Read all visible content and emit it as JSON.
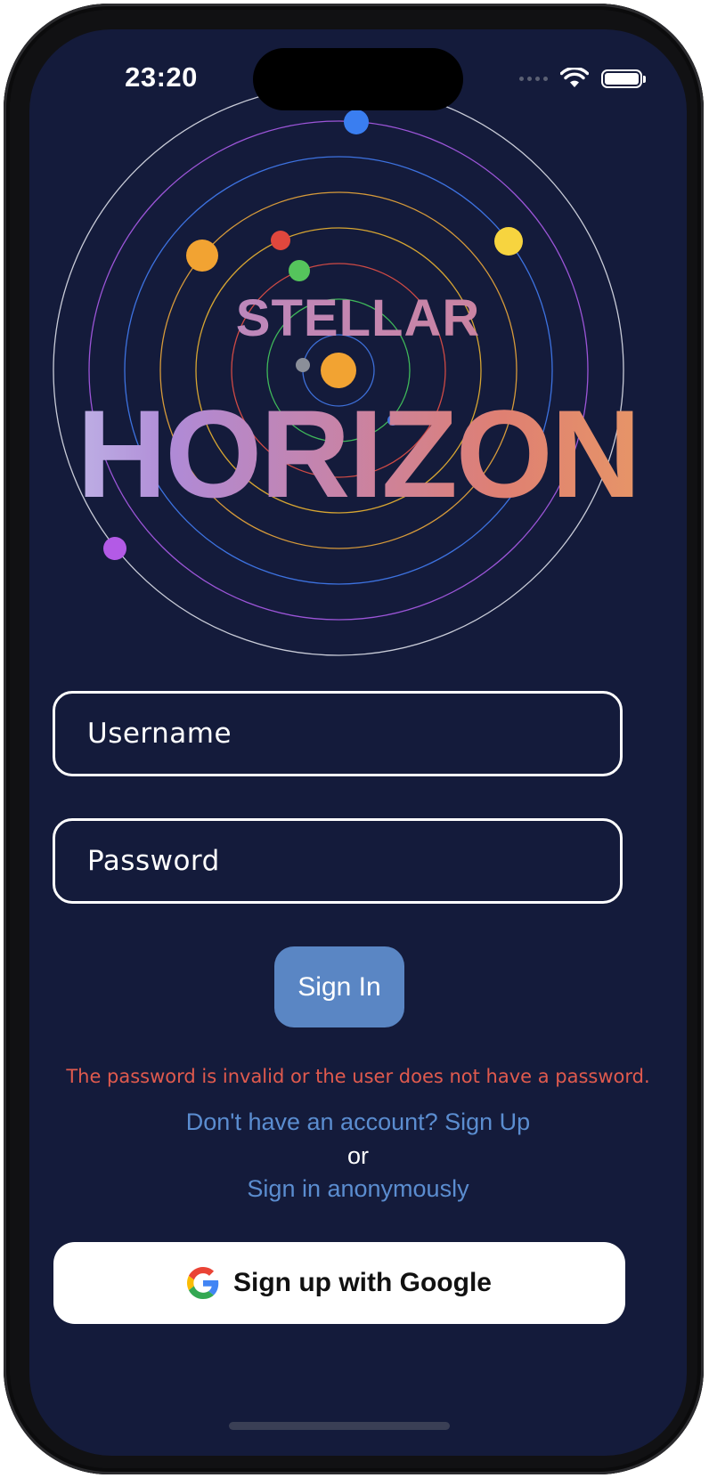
{
  "status_bar": {
    "time": "23:20"
  },
  "title": {
    "line1": "STELLAR",
    "line2": "HORIZON"
  },
  "form": {
    "username_placeholder": "Username",
    "password_placeholder": "Password",
    "sign_in_label": "Sign In"
  },
  "error_message": "The password is invalid or the user does not have a password.",
  "links": {
    "sign_up": "Don't have an account? Sign Up",
    "or": "or",
    "anonymous": "Sign in anonymously"
  },
  "google_button": {
    "label": "Sign up with Google",
    "icon": "google-g-icon"
  },
  "colors": {
    "background": "#141b3b",
    "accent_button": "#5a86c4",
    "link": "#5b8dd0",
    "error": "#e05a4e"
  }
}
